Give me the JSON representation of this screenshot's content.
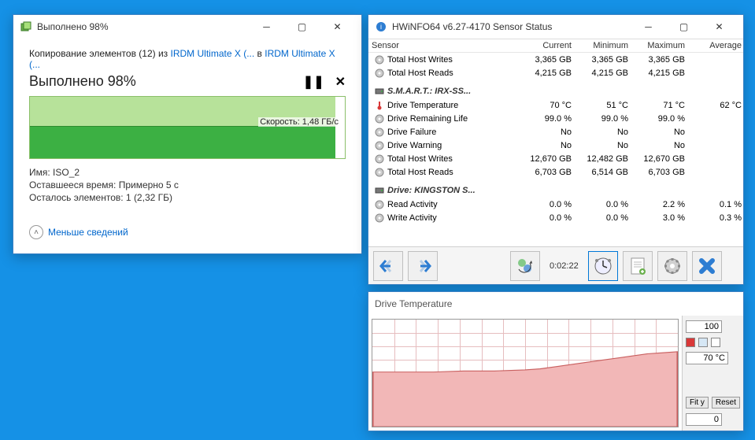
{
  "copy": {
    "window_title": "Выполнено 98%",
    "line1_prefix": "Копирование элементов (12) из ",
    "src": "IRDM Ultimate X (...",
    "mid": " в ",
    "dst": "IRDM Ultimate X (...",
    "progress_title": "Выполнено 98%",
    "pause_glyph": "❚❚",
    "cancel_glyph": "✕",
    "speed_label": "Скорость: 1,48 ГБ/с",
    "name_label": "Имя:  ISO_2",
    "remaining_time": "Оставшееся время:  Примерно 5 с",
    "remaining_items": "Осталось элементов:  1 (2,32 ГБ)",
    "less_info": "Меньше сведений"
  },
  "hwinfo": {
    "window_title": "HWiNFO64 v6.27-4170 Sensor Status",
    "headers": [
      "Sensor",
      "Current",
      "Minimum",
      "Maximum",
      "Average"
    ],
    "groups": [
      {
        "name": "",
        "rows": [
          {
            "label": "Total Host Writes",
            "cur": "3,365 GB",
            "min": "3,365 GB",
            "max": "3,365 GB",
            "avg": ""
          },
          {
            "label": "Total Host Reads",
            "cur": "4,215 GB",
            "min": "4,215 GB",
            "max": "4,215 GB",
            "avg": ""
          }
        ]
      },
      {
        "name": "S.M.A.R.T.: IRX-SS...",
        "rows": [
          {
            "label": "Drive Temperature",
            "cur": "70 °C",
            "min": "51 °C",
            "max": "71 °C",
            "avg": "62 °C",
            "icon": "temp"
          },
          {
            "label": "Drive Remaining Life",
            "cur": "99.0 %",
            "min": "99.0 %",
            "max": "99.0 %",
            "avg": ""
          },
          {
            "label": "Drive Failure",
            "cur": "No",
            "min": "No",
            "max": "No",
            "avg": ""
          },
          {
            "label": "Drive Warning",
            "cur": "No",
            "min": "No",
            "max": "No",
            "avg": ""
          },
          {
            "label": "Total Host Writes",
            "cur": "12,670 GB",
            "min": "12,482 GB",
            "max": "12,670 GB",
            "avg": ""
          },
          {
            "label": "Total Host Reads",
            "cur": "6,703 GB",
            "min": "6,514 GB",
            "max": "6,703 GB",
            "avg": ""
          }
        ]
      },
      {
        "name": "Drive: KINGSTON S...",
        "rows": [
          {
            "label": "Read Activity",
            "cur": "0.0 %",
            "min": "0.0 %",
            "max": "2.2 %",
            "avg": "0.1 %"
          },
          {
            "label": "Write Activity",
            "cur": "0.0 %",
            "min": "0.0 %",
            "max": "3.0 %",
            "avg": "0.3 %"
          }
        ]
      }
    ],
    "elapsed": "0:02:22"
  },
  "chart": {
    "window_title": "Drive Temperature",
    "ymax": "100",
    "current": "70 °C",
    "bottom": "0",
    "fit_y": "Fit y",
    "reset": "Reset"
  },
  "chart_data": {
    "type": "line",
    "title": "Drive Temperature",
    "ylabel": "°C",
    "ylim": [
      0,
      100
    ],
    "x_fraction": [
      0,
      0.1,
      0.2,
      0.3,
      0.4,
      0.5,
      0.55,
      0.6,
      0.65,
      0.7,
      0.75,
      0.8,
      0.85,
      0.9,
      0.95,
      1.0
    ],
    "values": [
      51,
      51,
      51,
      52,
      52,
      53,
      54,
      56,
      58,
      60,
      62,
      64,
      66,
      68,
      69,
      70
    ],
    "color": "#c96060"
  }
}
